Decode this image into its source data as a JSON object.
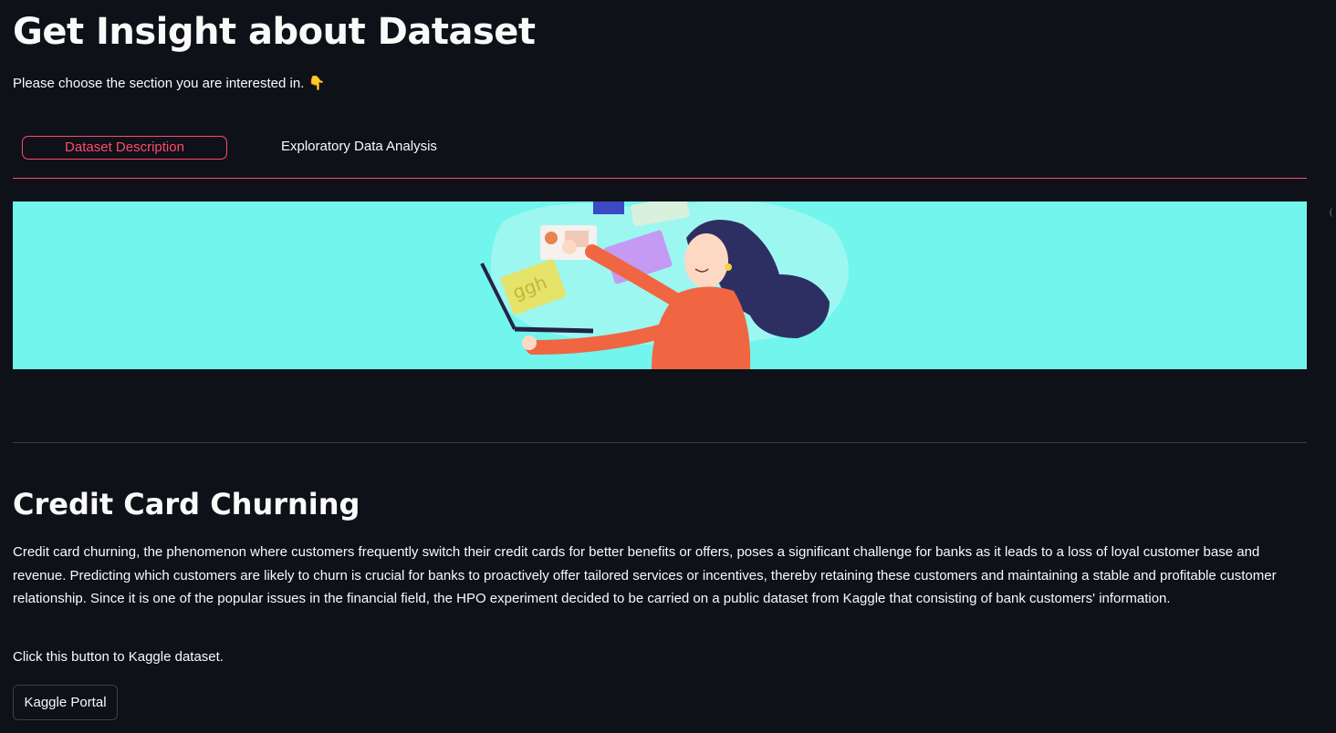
{
  "header": {
    "title": "Get Insight about Dataset",
    "subtitle": "Please choose the section you are interested in. 👇"
  },
  "tabs": [
    {
      "label": "Dataset Description",
      "active": true
    },
    {
      "label": "Exploratory Data Analysis",
      "active": false
    }
  ],
  "banner": {
    "illustration": "woman-with-laptop-and-credit-cards",
    "background": "#72f5ec"
  },
  "section": {
    "title": "Credit Card Churning",
    "description": "Credit card churning, the phenomenon where customers frequently switch their credit cards for better benefits or offers, poses a significant challenge for banks as it leads to a loss of loyal customer base and revenue. Predicting which customers are likely to churn is crucial for banks to proactively offer tailored services or incentives, thereby retaining these customers and maintaining a stable and profitable customer relationship. Since it is one of the popular issues in the financial field, the HPO experiment decided to be carried on a public dataset from Kaggle that consisting of bank customers' information.",
    "hint": "Click this button to Kaggle dataset.",
    "button_label": "Kaggle Portal"
  },
  "colors": {
    "background": "#0e1117",
    "accent": "#ff4b6e",
    "text": "#fafafa"
  }
}
